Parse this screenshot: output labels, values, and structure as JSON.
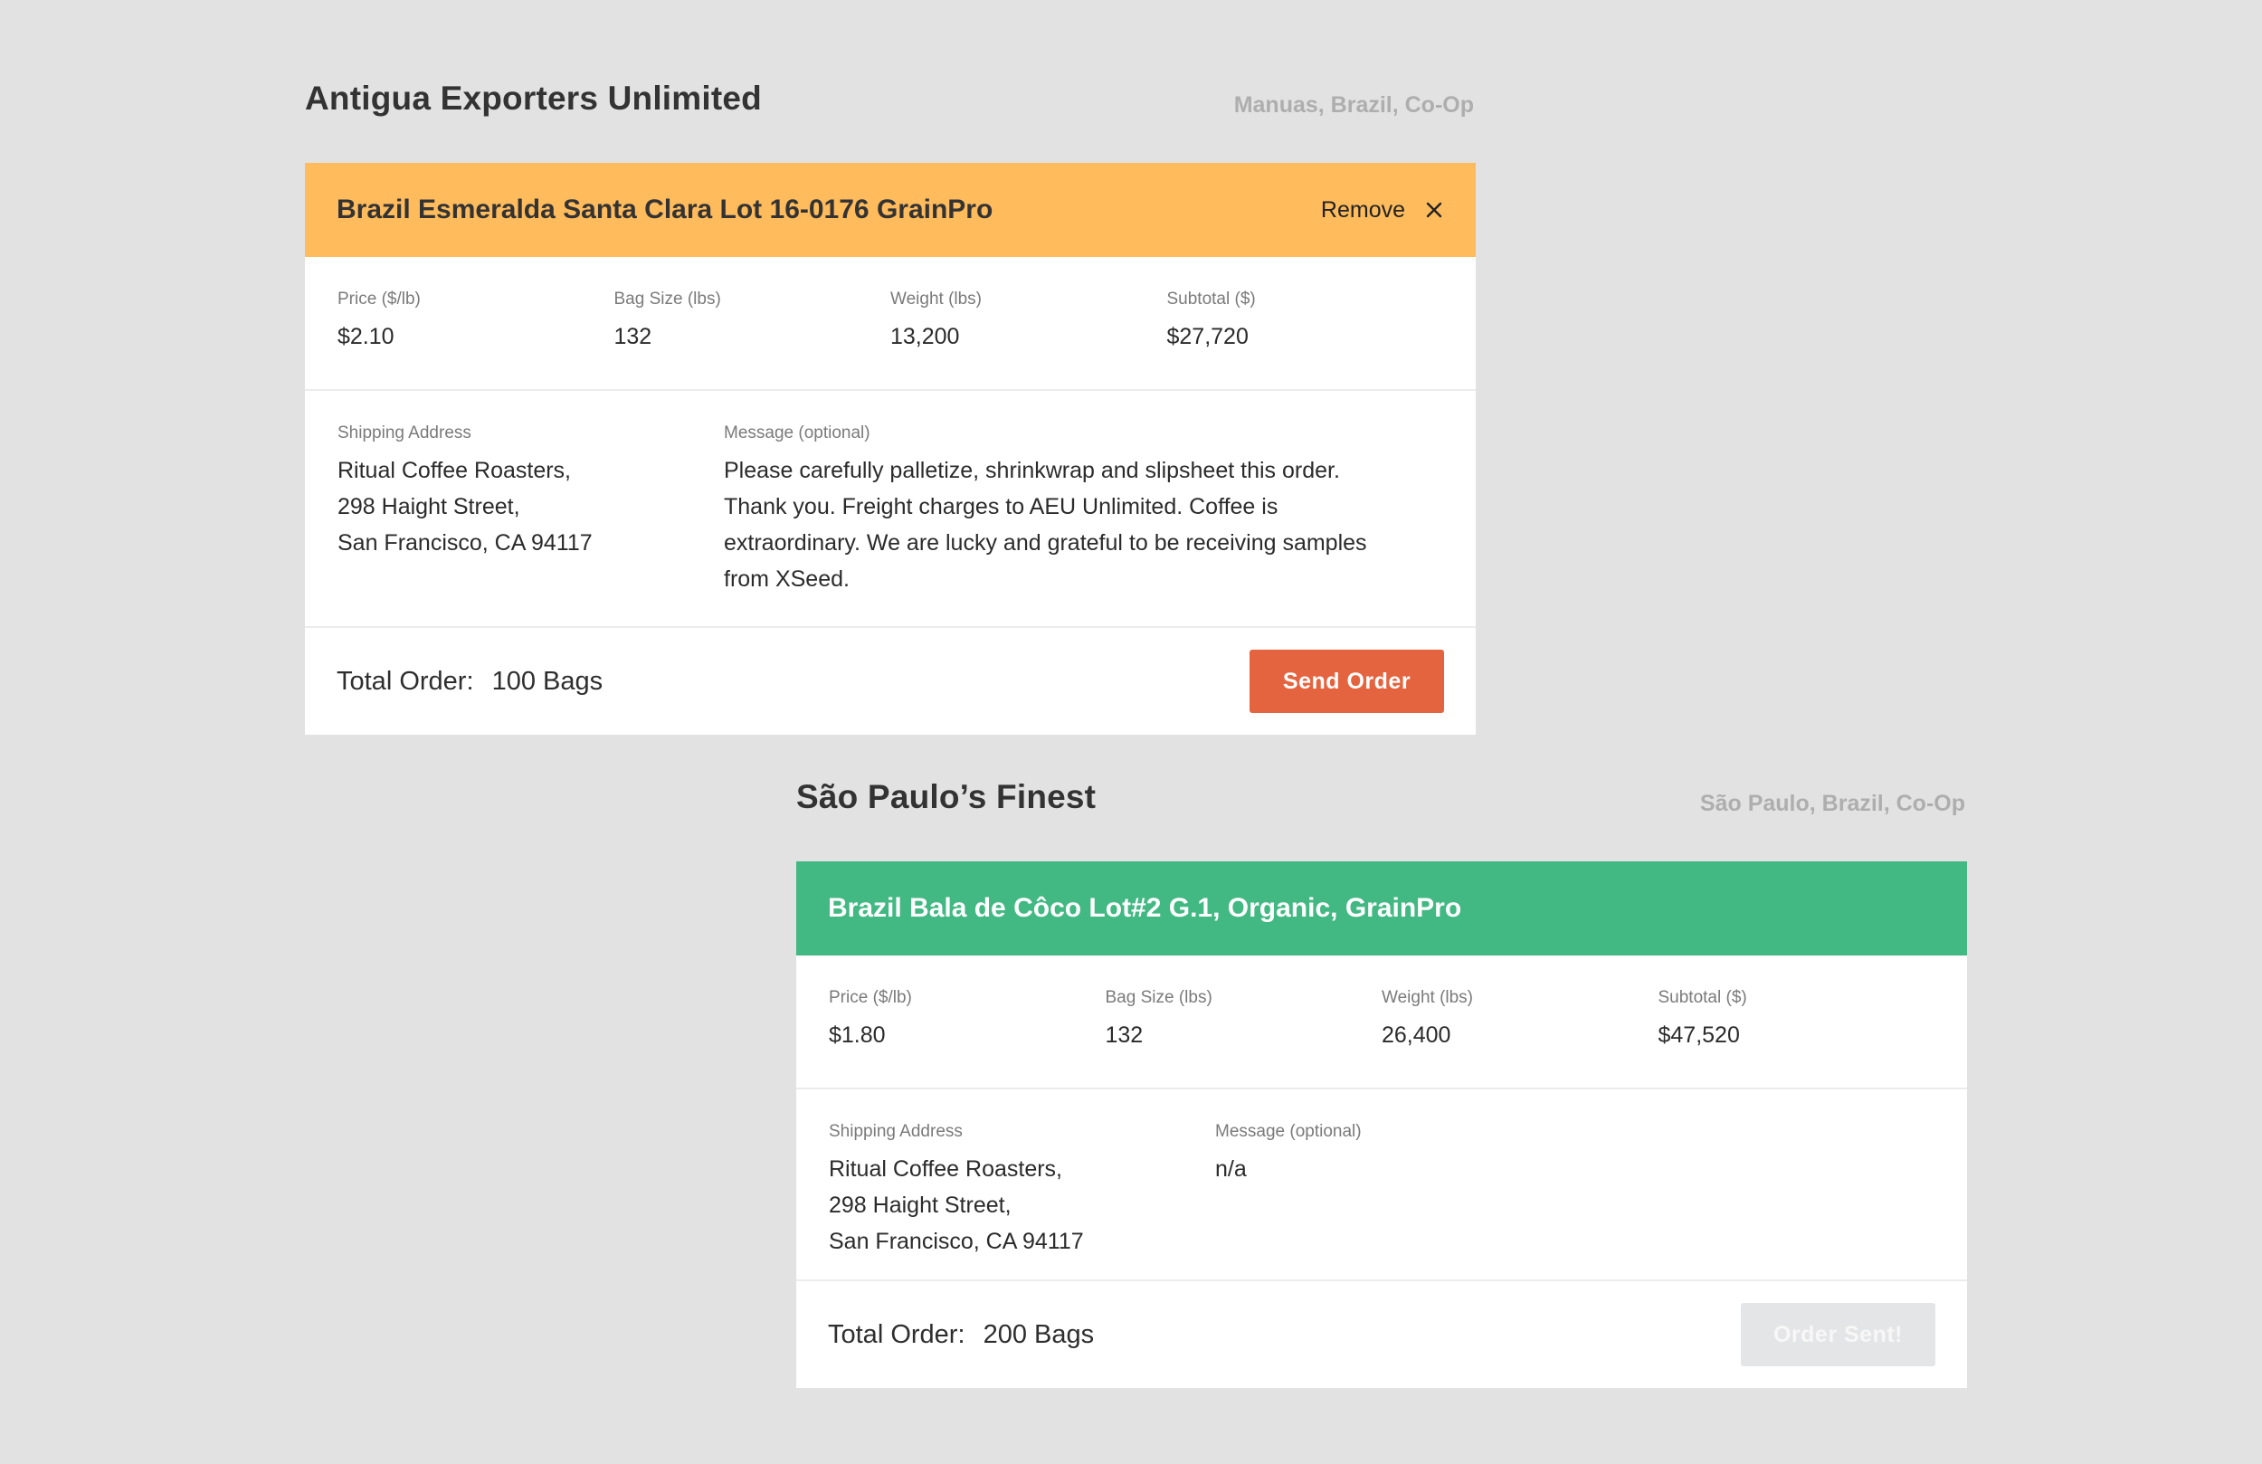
{
  "vendors": [
    {
      "name": "Antigua Exporters Unlimited",
      "location": "Manuas, Brazil, Co-Op",
      "lot": {
        "title": "Brazil Esmeralda Santa Clara Lot 16-0176 GrainPro",
        "header_color": "#ffbb5c",
        "remove_label": "Remove",
        "remove_icon": "close-icon"
      },
      "specs": {
        "price_label": "Price ($/lb)",
        "price": "$2.10",
        "bag_size_label": "Bag Size (lbs)",
        "bag_size": "132",
        "weight_label": "Weight (lbs)",
        "weight": "13,200",
        "subtotal_label": "Subtotal ($)",
        "subtotal": "$27,720"
      },
      "shipping": {
        "label": "Shipping Address",
        "value": "Ritual Coffee Roasters,\n298 Haight Street,\nSan Francisco, CA 94117"
      },
      "message": {
        "label": "Message (optional)",
        "value": "Please carefully palletize, shrinkwrap and slipsheet this order.\nThank you. Freight charges to AEU Unlimited. Coffee is\nextraordinary. We are lucky and grateful to be receiving samples\nfrom XSeed."
      },
      "total": {
        "label": "Total Order:",
        "value": "100 Bags"
      },
      "action": {
        "label": "Send Order",
        "color": "#e4643f"
      }
    },
    {
      "name": "São Paulo’s Finest",
      "location": "São Paulo, Brazil, Co-Op",
      "lot": {
        "title": "Brazil Bala de Côco Lot#2 G.1, Organic, GrainPro",
        "header_color": "#42b883"
      },
      "specs": {
        "price_label": "Price ($/lb)",
        "price": "$1.80",
        "bag_size_label": "Bag Size (lbs)",
        "bag_size": "132",
        "weight_label": "Weight (lbs)",
        "weight": "26,400",
        "subtotal_label": "Subtotal ($)",
        "subtotal": "$47,520"
      },
      "shipping": {
        "label": "Shipping Address",
        "value": "Ritual Coffee Roasters,\n298 Haight Street,\nSan Francisco, CA 94117"
      },
      "message": {
        "label": "Message (optional)",
        "value": "n/a"
      },
      "total": {
        "label": "Total Order:",
        "value": "200 Bags"
      },
      "action": {
        "label": "Order Sent!",
        "color": "#e4e5e6"
      }
    }
  ]
}
